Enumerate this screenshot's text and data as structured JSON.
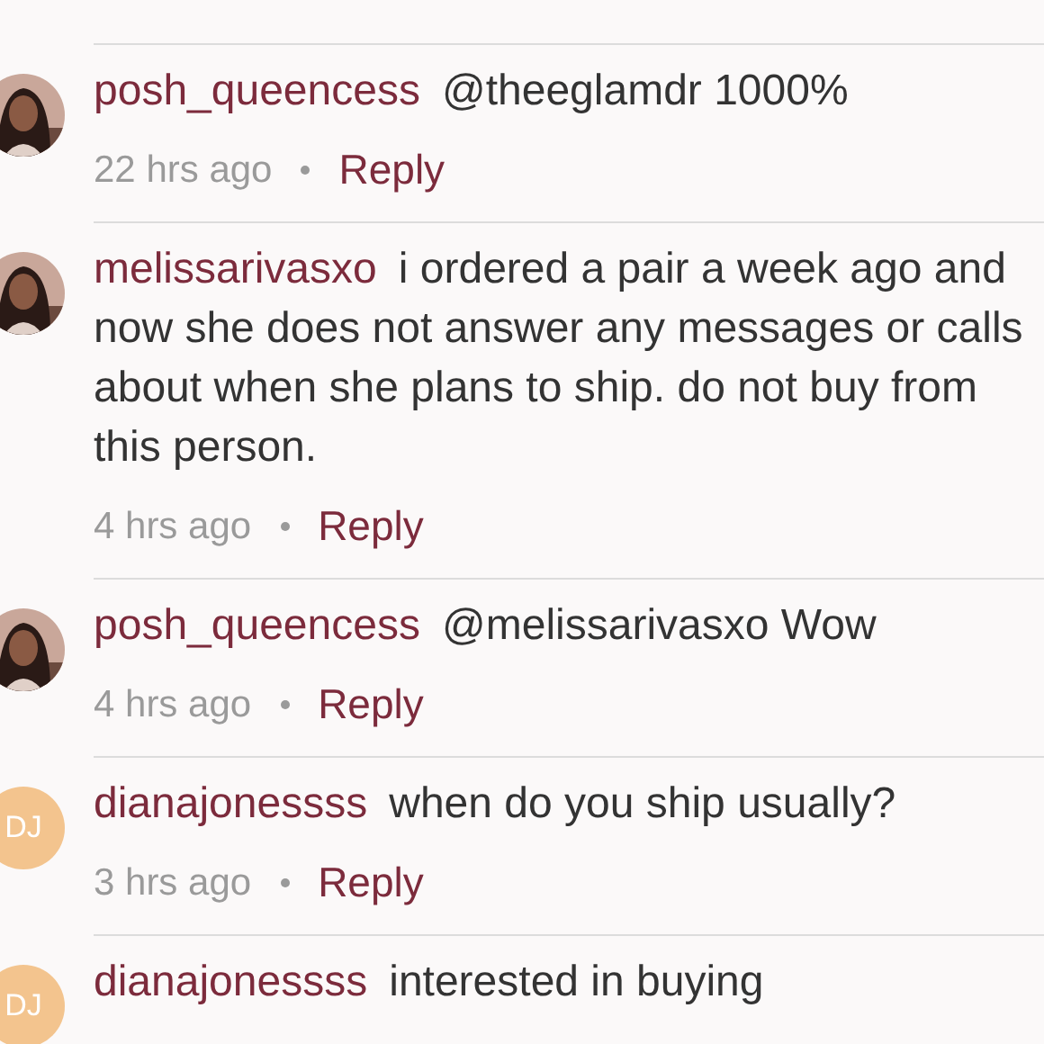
{
  "comments": [
    {
      "username": "posh_queencess",
      "text": "@theeglamdr 1000%",
      "time": "22 hrs ago",
      "reply": "Reply"
    },
    {
      "username": "melissarivasxo",
      "text": "i ordered a pair a week ago and now she does not answer any messages or calls about when she plans to ship. do not buy from this person.",
      "time": "4 hrs ago",
      "reply": "Reply"
    },
    {
      "username": "posh_queencess",
      "text": "@melissarivasxo Wow",
      "time": "4 hrs ago",
      "reply": "Reply"
    },
    {
      "avatar": {
        "kind": "initials",
        "initials": "DJ"
      },
      "username": "dianajonessss",
      "text": "when do you ship usually?",
      "time": "3 hrs ago",
      "reply": "Reply"
    },
    {
      "avatar": {
        "kind": "initials",
        "initials": "DJ"
      },
      "username": "dianajonessss",
      "text": "interested in buying"
    }
  ]
}
